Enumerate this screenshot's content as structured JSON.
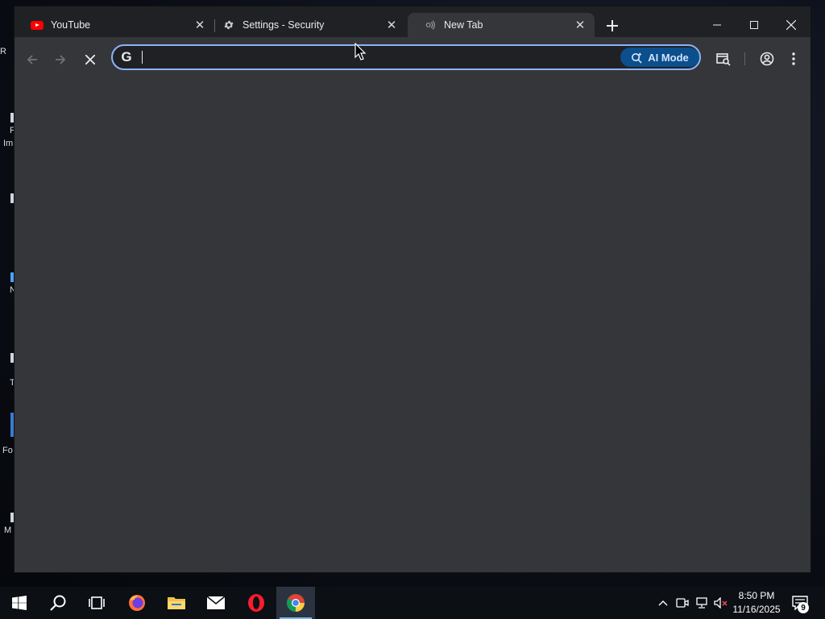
{
  "tabs": [
    {
      "title": "YouTube",
      "icon": "youtube-icon"
    },
    {
      "title": "Settings - Security",
      "icon": "gear-icon"
    },
    {
      "title": "New Tab",
      "icon": "chrome-labs-icon",
      "active": true
    }
  ],
  "omnibox": {
    "value": "",
    "ai_mode_label": "AI Mode"
  },
  "taskbar": {
    "apps": [
      "start",
      "search",
      "task-view",
      "firefox",
      "file-explorer",
      "mail",
      "opera",
      "chrome"
    ],
    "active_app": "chrome",
    "time": "8:50 PM",
    "date": "11/16/2025",
    "notification_count": "9"
  },
  "desktop_fragments": [
    "R",
    "F",
    "Im",
    "N",
    "T",
    "Fo",
    "M"
  ],
  "colors": {
    "accent": "#8ab4f8",
    "ai_mode_bg": "#0b4f8c",
    "page_bg": "#35363a",
    "tabstrip_bg": "#202124"
  }
}
